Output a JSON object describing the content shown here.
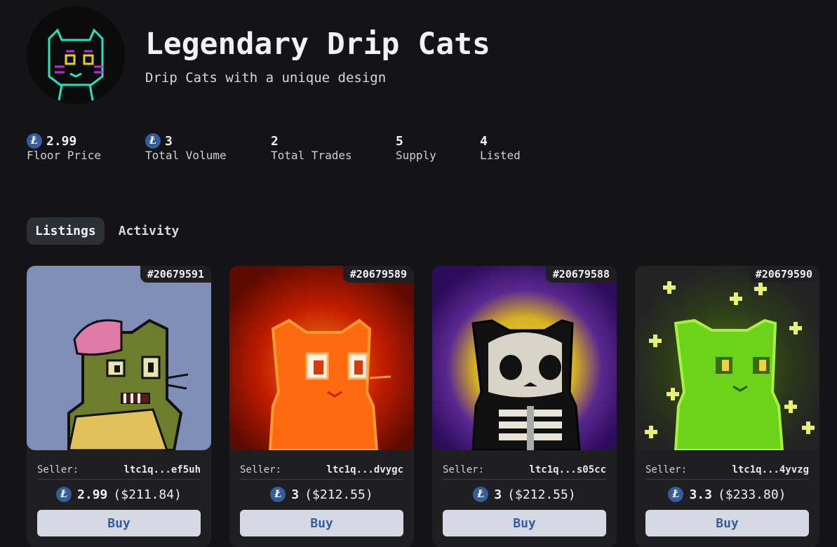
{
  "collection": {
    "title": "Legendary Drip Cats",
    "subtitle": "Drip Cats with a unique design"
  },
  "stats": [
    {
      "value": "2.99",
      "label": "Floor Price",
      "currency_icon": "litecoin-icon"
    },
    {
      "value": "3",
      "label": "Total Volume",
      "currency_icon": "litecoin-icon"
    },
    {
      "value": "2",
      "label": "Total Trades"
    },
    {
      "value": "5",
      "label": "Supply"
    },
    {
      "value": "4",
      "label": "Listed"
    }
  ],
  "tabs": [
    {
      "label": "Listings",
      "active": true
    },
    {
      "label": "Activity",
      "active": false
    }
  ],
  "listings": [
    {
      "id": "#20679591",
      "seller_label": "Seller:",
      "seller": "ltc1q...ef5uh",
      "price": "2.99",
      "usd": "($211.84)",
      "buy_label": "Buy",
      "art": "zombie-cat",
      "bg": "#7f8fb8"
    },
    {
      "id": "#20679589",
      "seller_label": "Seller:",
      "seller": "ltc1q...dvygc",
      "price": "3",
      "usd": "($212.55)",
      "buy_label": "Buy",
      "art": "fire-cat",
      "bg": "#7a0d00"
    },
    {
      "id": "#20679588",
      "seller_label": "Seller:",
      "seller": "ltc1q...s05cc",
      "price": "3",
      "usd": "($212.55)",
      "buy_label": "Buy",
      "art": "skeleton-cat",
      "bg": "#3a1070"
    },
    {
      "id": "#20679590",
      "seller_label": "Seller:",
      "seller": "ltc1q...4yvzg",
      "price": "3.3",
      "usd": "($233.80)",
      "buy_label": "Buy",
      "art": "toxic-cat",
      "bg": "#232323"
    }
  ],
  "currency_symbol": "Ł"
}
